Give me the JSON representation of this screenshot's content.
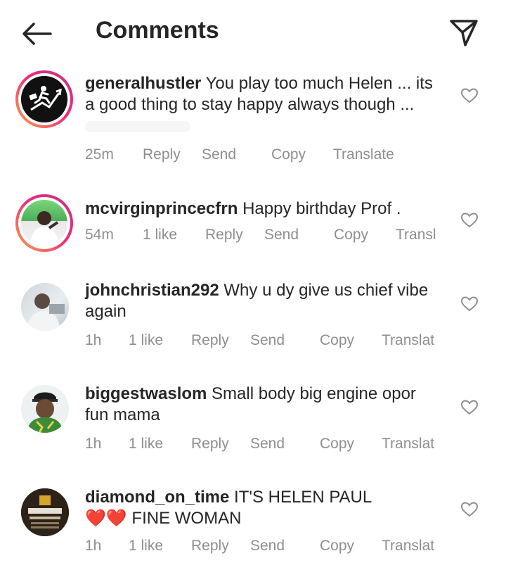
{
  "header": {
    "title": "Comments",
    "back_icon": "arrow-left-icon",
    "share_icon": "paper-plane-icon"
  },
  "comments": [
    {
      "username": "generalhustler",
      "text": "You play too much Helen ... its a good thing to stay happy always though ...",
      "time": "25m",
      "likes": "",
      "reply": "Reply",
      "send": "Send",
      "copy": "Copy",
      "translate": "Translate"
    },
    {
      "username": "mcvirginprincecfrn",
      "text": "Happy birthday Prof .",
      "time": "54m",
      "likes": "1 like",
      "reply": "Reply",
      "send": "Send",
      "copy": "Copy",
      "translate": "Transl"
    },
    {
      "username": "johnchristian292",
      "text": "Why u dy give us chief vibe again",
      "time": "1h",
      "likes": "1 like",
      "reply": "Reply",
      "send": "Send",
      "copy": "Copy",
      "translate": "Translat"
    },
    {
      "username": "biggestwaslom",
      "text": "Small body big engine opor fun mama",
      "time": "1h",
      "likes": "1 like",
      "reply": "Reply",
      "send": "Send",
      "copy": "Copy",
      "translate": "Translat"
    },
    {
      "username": "diamond_on_time",
      "text": "IT'S HELEN PAUL",
      "text2": "❤️❤️ FINE WOMAN",
      "time": "1h",
      "likes": "1 like",
      "reply": "Reply",
      "send": "Send",
      "copy": "Copy",
      "translate": "Translat"
    }
  ],
  "colors": {
    "meta_text": "#8e8e8e",
    "story_ring_start": "#f9a34b",
    "story_ring_end": "#c13584"
  }
}
